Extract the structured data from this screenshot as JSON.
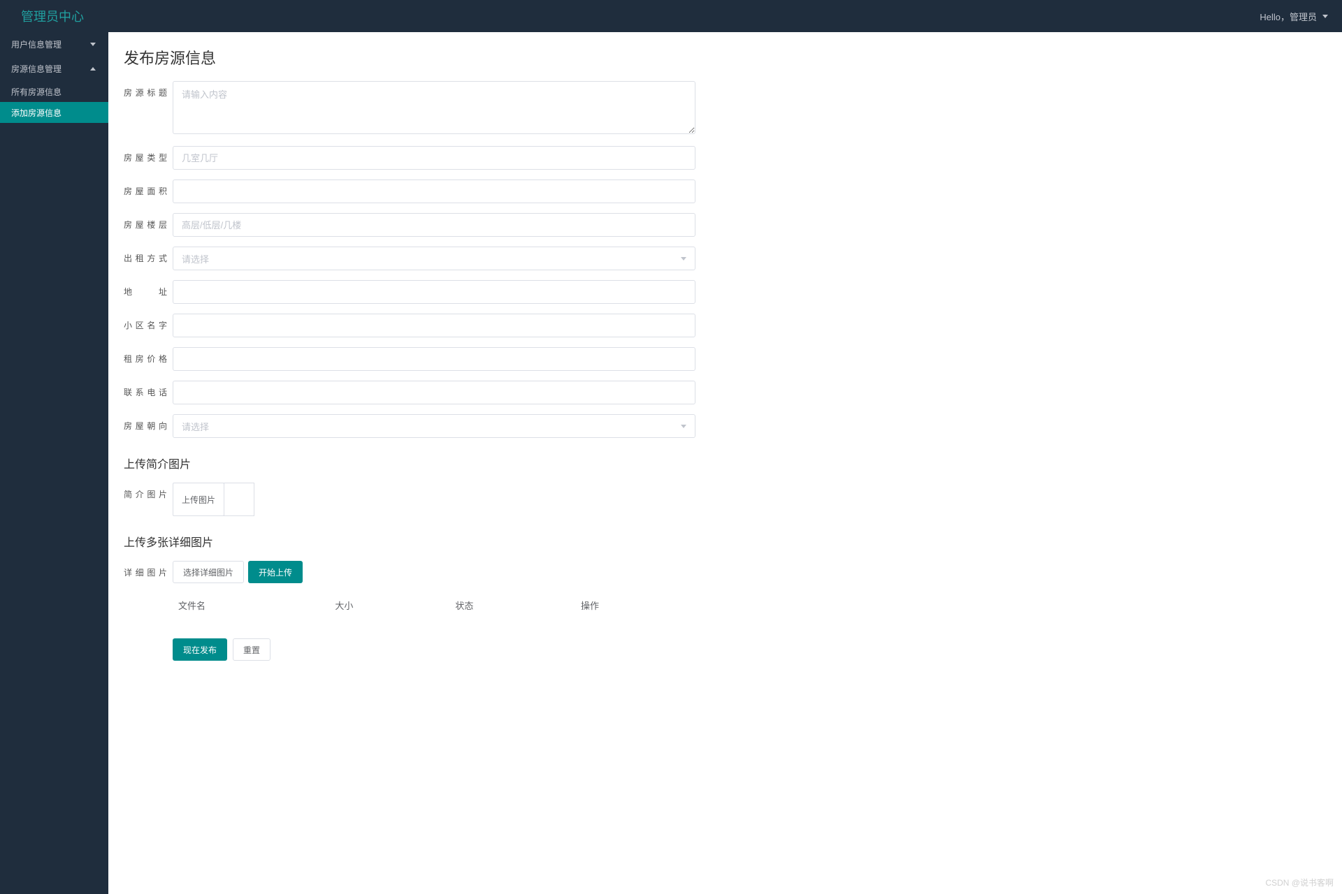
{
  "header": {
    "brand": "管理员中心",
    "greeting": "Hello，管理员"
  },
  "sidebar": {
    "items": [
      {
        "label": "用户信息管理",
        "expanded": false
      },
      {
        "label": "房源信息管理",
        "expanded": true,
        "children": [
          {
            "label": "所有房源信息",
            "active": false
          },
          {
            "label": "添加房源信息",
            "active": true
          }
        ]
      }
    ]
  },
  "page": {
    "title": "发布房源信息",
    "section_upload_simple": "上传简介图片",
    "section_upload_detail": "上传多张详细图片"
  },
  "form": {
    "title_label": "房源标题",
    "title_placeholder": "请输入内容",
    "type_label": "房屋类型",
    "type_placeholder": "几室几厅",
    "area_label": "房屋面积",
    "floor_label": "房屋楼层",
    "floor_placeholder": "高层/低层/几楼",
    "rent_mode_label": "出租方式",
    "rent_mode_placeholder": "请选择",
    "address_label": "地　　址",
    "community_label": "小区名字",
    "price_label": "租房价格",
    "phone_label": "联系电话",
    "orientation_label": "房屋朝向",
    "orientation_placeholder": "请选择",
    "simple_img_label": "简介图片",
    "upload_img_btn": "上传图片",
    "detail_img_label": "详细图片",
    "select_detail_btn": "选择详细图片",
    "start_upload_btn": "开始上传"
  },
  "table": {
    "headers": [
      "文件名",
      "大小",
      "状态",
      "操作"
    ]
  },
  "actions": {
    "publish": "现在发布",
    "reset": "重置"
  },
  "watermark": "CSDN @说书客啊"
}
